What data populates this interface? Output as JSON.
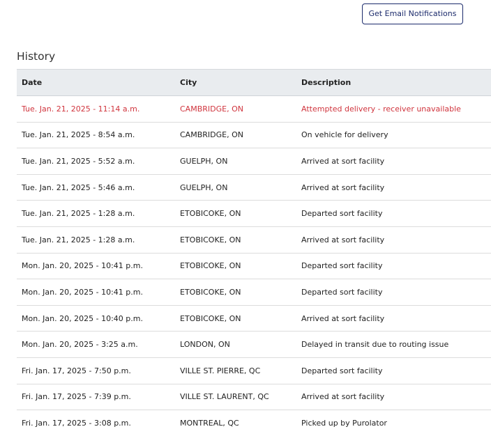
{
  "notify_button": {
    "label": "Get Email Notifications"
  },
  "history": {
    "title": "History",
    "columns": {
      "date": "Date",
      "city": "City",
      "description": "Description"
    },
    "highlight_color": "#d0343d",
    "rows": [
      {
        "date": "Tue. Jan. 21, 2025 - 11:14 a.m.",
        "city": "CAMBRIDGE, ON",
        "description": "Attempted delivery - receiver unavailable"
      },
      {
        "date": "Tue. Jan. 21, 2025 - 8:54 a.m.",
        "city": "CAMBRIDGE, ON",
        "description": "On vehicle for delivery"
      },
      {
        "date": "Tue. Jan. 21, 2025 - 5:52 a.m.",
        "city": "GUELPH, ON",
        "description": "Arrived at sort facility"
      },
      {
        "date": "Tue. Jan. 21, 2025 - 5:46 a.m.",
        "city": "GUELPH, ON",
        "description": "Arrived at sort facility"
      },
      {
        "date": "Tue. Jan. 21, 2025 - 1:28 a.m.",
        "city": "ETOBICOKE, ON",
        "description": "Departed sort facility"
      },
      {
        "date": "Tue. Jan. 21, 2025 - 1:28 a.m.",
        "city": "ETOBICOKE, ON",
        "description": "Arrived at sort facility"
      },
      {
        "date": "Mon. Jan. 20, 2025 - 10:41 p.m.",
        "city": "ETOBICOKE, ON",
        "description": "Departed sort facility"
      },
      {
        "date": "Mon. Jan. 20, 2025 - 10:41 p.m.",
        "city": "ETOBICOKE, ON",
        "description": "Departed sort facility"
      },
      {
        "date": "Mon. Jan. 20, 2025 - 10:40 p.m.",
        "city": "ETOBICOKE, ON",
        "description": "Arrived at sort facility"
      },
      {
        "date": "Mon. Jan. 20, 2025 - 3:25 a.m.",
        "city": "LONDON, ON",
        "description": "Delayed in transit due to routing issue"
      },
      {
        "date": "Fri. Jan. 17, 2025 - 7:50 p.m.",
        "city": "VILLE ST. PIERRE, QC",
        "description": "Departed sort facility"
      },
      {
        "date": "Fri. Jan. 17, 2025 - 7:39 p.m.",
        "city": "VILLE ST. LAURENT, QC",
        "description": "Arrived at sort facility"
      },
      {
        "date": "Fri. Jan. 17, 2025 - 3:08 p.m.",
        "city": "MONTREAL, QC",
        "description": "Picked up by Purolator"
      }
    ]
  }
}
